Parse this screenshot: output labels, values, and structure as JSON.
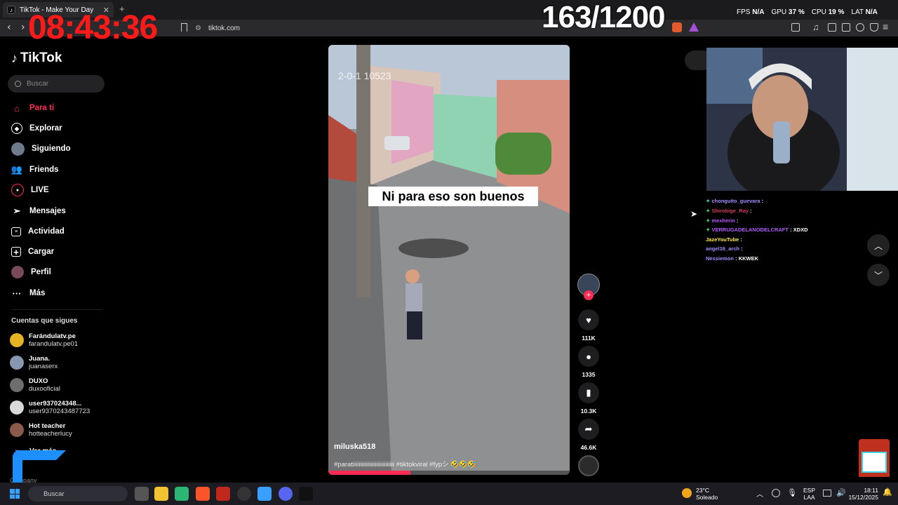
{
  "browser": {
    "tab_title": "TikTok - Make Your Day",
    "url": "tiktok.com"
  },
  "overlay": {
    "clock": "08:43:36",
    "counter": "163/1200",
    "fps_label": "FPS",
    "fps_value": "N/A",
    "gpu_label": "GPU",
    "gpu_value": "37 %",
    "cpu_label": "CPU",
    "cpu_value": "19 %",
    "lat_label": "LAT",
    "lat_value": "N/A"
  },
  "sidebar": {
    "logo": "TikTok",
    "search_placeholder": "Buscar",
    "items": [
      {
        "label": "Para ti",
        "icon": "home-icon"
      },
      {
        "label": "Explorar",
        "icon": "compass-icon"
      },
      {
        "label": "Siguiendo",
        "icon": "following-avatar-icon"
      },
      {
        "label": "Friends",
        "icon": "friends-icon"
      },
      {
        "label": "LIVE",
        "icon": "live-icon"
      },
      {
        "label": "Mensajes",
        "icon": "send-icon"
      },
      {
        "label": "Actividad",
        "icon": "activity-icon"
      },
      {
        "label": "Cargar",
        "icon": "upload-icon"
      },
      {
        "label": "Perfil",
        "icon": "profile-icon"
      },
      {
        "label": "Más",
        "icon": "more-icon"
      }
    ],
    "following_title": "Cuentas que sigues",
    "accounts": [
      {
        "name": "Farándulatv.pe",
        "handle": "farandulatv.pe01"
      },
      {
        "name": "Juana.",
        "handle": "juanaserx"
      },
      {
        "name": "DUXO",
        "handle": "duxooficial"
      },
      {
        "name": "user937024348...",
        "handle": "user9370243487723"
      },
      {
        "name": "Hot teacher",
        "handle": "hotteacherlucy"
      }
    ],
    "see_more": "Ver más",
    "company": "Company"
  },
  "video": {
    "timestamp_overlay": "2-0-1 10523",
    "caption": "Ni para eso son buenos",
    "author": "miluska518",
    "description": "#paratiiiiiiiiiiiiiiiiiiiiiiiiiiii #tiktokviral #fypシ 🤣🤣🤣"
  },
  "actions": {
    "likes": "111K",
    "comments": "1335",
    "saves": "10.3K",
    "shares": "46.6K"
  },
  "chat": [
    {
      "user": "chonguito_guevara",
      "msg": "",
      "color": "#a58cff"
    },
    {
      "user": "Shirobige_Ray",
      "msg": "",
      "color": "#d23c5a"
    },
    {
      "user": "mexherin",
      "msg": "",
      "color": "#b45aff"
    },
    {
      "user": "VERRUGADELANODELCRAFT",
      "msg": "XDXD",
      "color": "#b45aff"
    },
    {
      "user": "JazeYouTube",
      "msg": "",
      "color": "#ffee44"
    },
    {
      "user": "angel16_arch",
      "msg": "",
      "color": "#a58cff"
    },
    {
      "user": "Nessiemon",
      "msg": "KKWEK",
      "color": "#a58cff"
    }
  ],
  "taskbar": {
    "search": "Buscar",
    "weather_temp": "23°C",
    "weather_desc": "Soleado",
    "lang1": "ESP",
    "lang2": "LAA",
    "time": "18:11",
    "date": "15/12/2025"
  },
  "colors": {
    "accent": "#fe2c55",
    "clock": "#ff1a1a"
  }
}
